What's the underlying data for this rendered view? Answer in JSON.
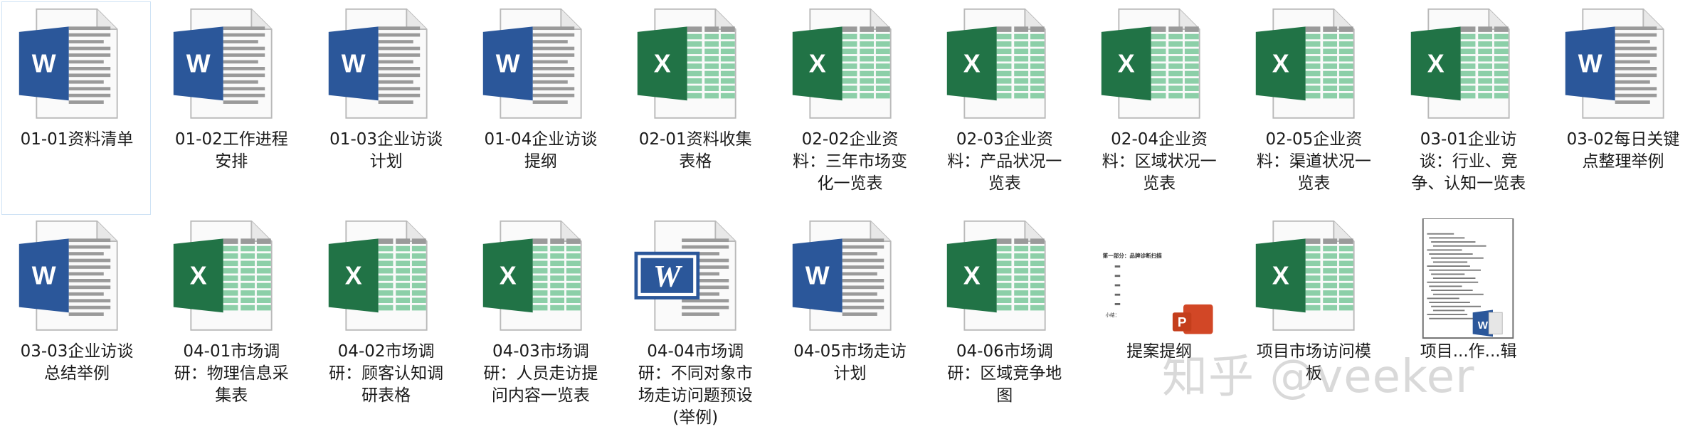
{
  "files": [
    {
      "label": "01-01资料清单",
      "type": "word"
    },
    {
      "label": "01-02工作进程\n安排",
      "type": "word"
    },
    {
      "label": "01-03企业访谈\n计划",
      "type": "word"
    },
    {
      "label": "01-04企业访谈\n提纲",
      "type": "word"
    },
    {
      "label": "02-01资料收集\n表格",
      "type": "excel"
    },
    {
      "label": "02-02企业资\n料：三年市场变\n化一览表",
      "type": "excel"
    },
    {
      "label": "02-03企业资\n料：产品状况一\n览表",
      "type": "excel"
    },
    {
      "label": "02-04企业资\n料：区域状况一\n览表",
      "type": "excel"
    },
    {
      "label": "02-05企业资\n料：渠道状况一\n览表",
      "type": "excel"
    },
    {
      "label": "03-01企业访\n谈：行业、竞\n争、认知一览表",
      "type": "excel"
    },
    {
      "label": "03-02每日关键\n点整理举例",
      "type": "word"
    },
    {
      "label": "03-03企业访谈\n总结举例",
      "type": "word"
    },
    {
      "label": "04-01市场调\n研：物理信息采\n集表",
      "type": "excel"
    },
    {
      "label": "04-02市场调\n研：顾客认知调\n研表格",
      "type": "excel"
    },
    {
      "label": "04-03市场调\n研：人员走访提\n问内容一览表",
      "type": "excel"
    },
    {
      "label": "04-04市场调\n研：不同对象市\n场走访问题预设\n(举例)",
      "type": "word-classic"
    },
    {
      "label": "04-05市场走访\n计划",
      "type": "word"
    },
    {
      "label": "04-06市场调\n研：区域竞争地\n图",
      "type": "excel"
    },
    {
      "label": "提案提纲",
      "type": "ppt-thumb",
      "thumb_title": "第一部分：品牌诊断扫描",
      "thumb_note": "小结："
    },
    {
      "label": "项目市场访问模\n板",
      "type": "excel"
    },
    {
      "label": "项目...作...辑",
      "type": "doc-thumb"
    }
  ],
  "icon_letters": {
    "word": "W",
    "excel": "X",
    "ppt": "P"
  },
  "colors": {
    "word": "#2b579a",
    "excel": "#217346",
    "ppt": "#d24726",
    "selection": "#cfe3f5"
  },
  "watermark": "知乎 @veeker"
}
